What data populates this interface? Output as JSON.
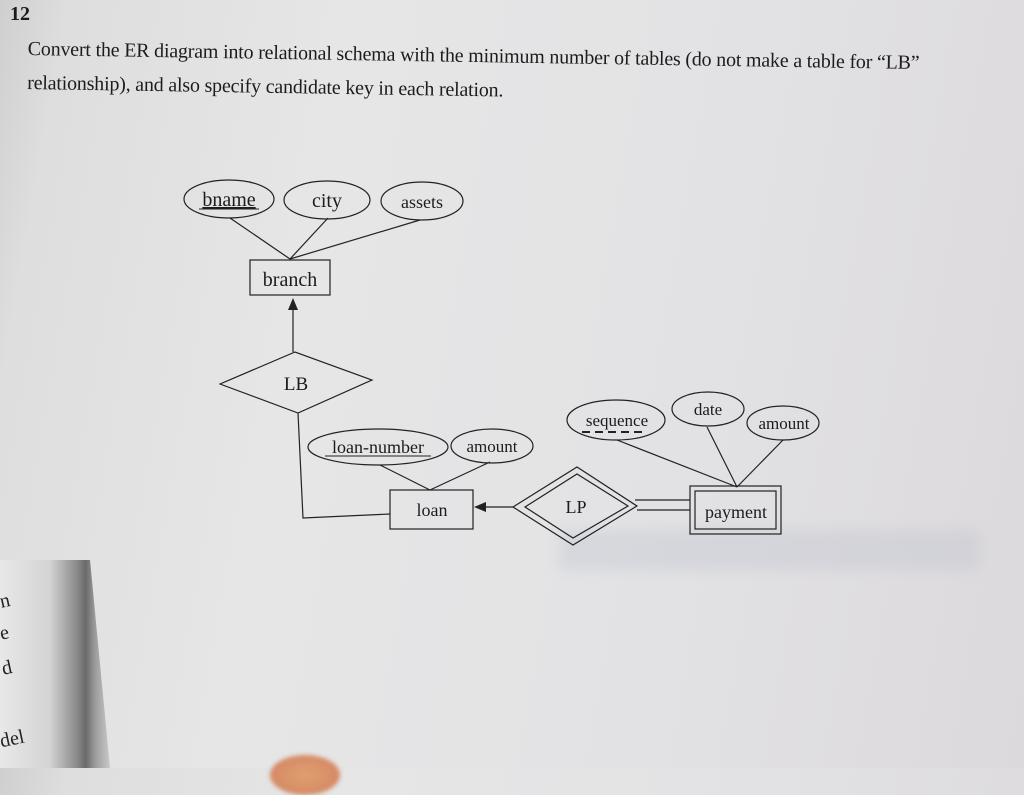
{
  "question": {
    "number": "12",
    "line1": "Convert the ER diagram into relational schema with the minimum number of tables (do not make a table for “LB”",
    "line2": "relationship), and also specify candidate key in each relation."
  },
  "margin_letters": [
    "n",
    "e",
    "d",
    "del"
  ],
  "diagram": {
    "entities": {
      "branch": "branch",
      "loan": "loan",
      "payment": "payment"
    },
    "relationships": {
      "lb": "LB",
      "lp": "LP"
    },
    "attributes": {
      "bname": "bname",
      "city": "city",
      "assets": "assets",
      "loan_number": "loan-number",
      "loan_amount": "amount",
      "sequence": "sequence",
      "date": "date",
      "payment_amount": "amount"
    },
    "keys": {
      "primary": [
        "bname",
        "loan-number"
      ],
      "partial": [
        "sequence"
      ]
    },
    "weak_entities": [
      "payment"
    ],
    "identifying_relationships": [
      "LP"
    ]
  }
}
